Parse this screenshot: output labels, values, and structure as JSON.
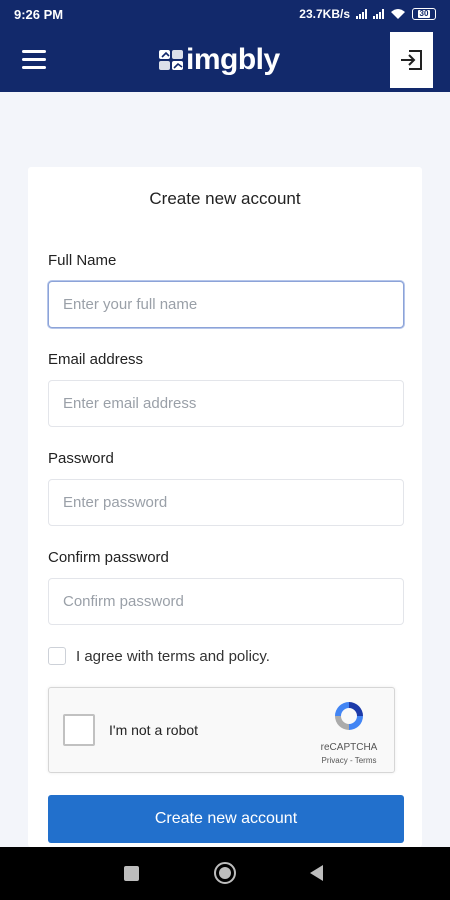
{
  "status_bar": {
    "time": "9:26 PM",
    "network_speed": "23.7KB/s",
    "battery": "30"
  },
  "app_bar": {
    "brand": "imgbly",
    "menu_icon": "hamburger-menu-icon",
    "login_icon": "login-enter-icon"
  },
  "form": {
    "title": "Create new account",
    "fields": [
      {
        "label": "Full Name",
        "placeholder": "Enter your full name",
        "value": ""
      },
      {
        "label": "Email address",
        "placeholder": "Enter email address",
        "value": ""
      },
      {
        "label": "Password",
        "placeholder": "Enter password",
        "value": ""
      },
      {
        "label": "Confirm password",
        "placeholder": "Confirm password",
        "value": ""
      }
    ],
    "agree_label": "I agree with terms and policy.",
    "agree_checked": false,
    "recaptcha": {
      "label": "I'm not a robot",
      "brand": "reCAPTCHA",
      "links": "Privacy - Terms"
    },
    "submit_label": "Create new account"
  },
  "colors": {
    "header_bg": "#12296b",
    "page_bg": "#f3f5fa",
    "button_bg": "#2270cc"
  }
}
